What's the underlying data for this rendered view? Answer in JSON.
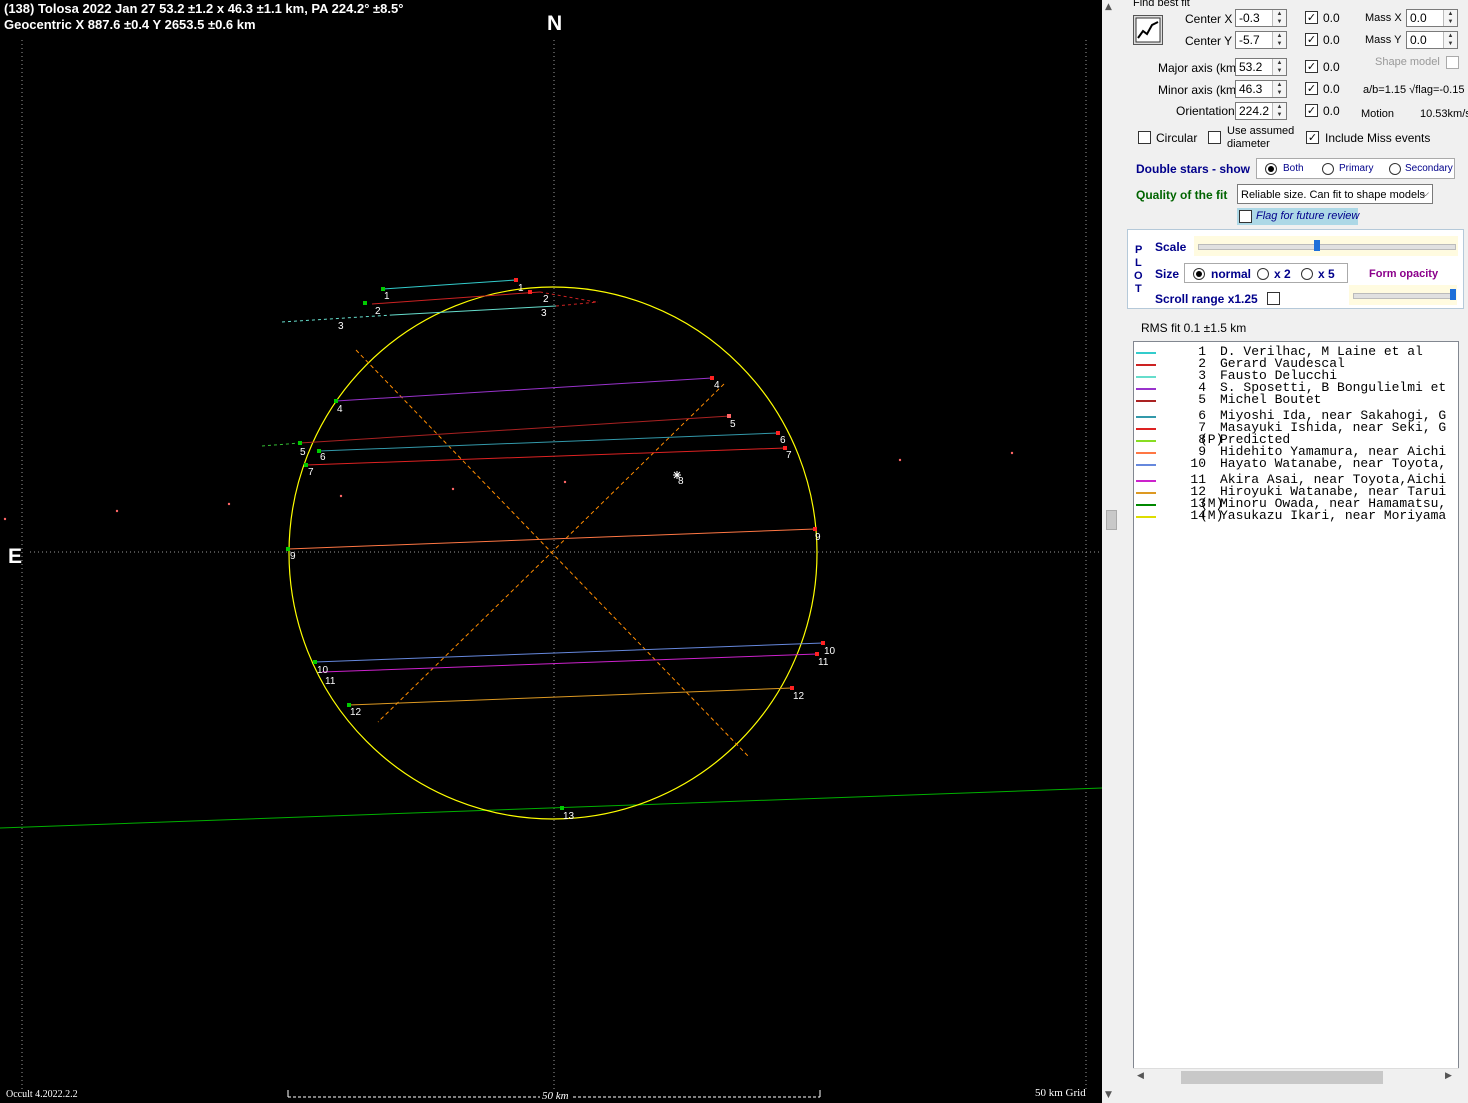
{
  "plot": {
    "title_line1": "(138) Tolosa  2022 Jan 27  53.2 ±1.2 x 46.3 ±1.1 km, PA 224.2° ±8.5°",
    "title_line2": "Geocentric  X  887.6 ±0.4  Y 2653.5 ±0.6 km",
    "north_label": "N",
    "east_label": "E",
    "version": "Occult 4.2022.2.2",
    "scale_bar_label": "50 km",
    "grid_label": "50 km Grid",
    "center_label": "8",
    "colors": {
      "background": "#000000",
      "ellipse": "#ffff00",
      "axes": "#ff8c00",
      "grid": "#9a9a9a",
      "predicted_path": "#00b000"
    }
  },
  "chords": [
    {
      "id": "1",
      "color": "#33cccc"
    },
    {
      "id": "2",
      "color": "#cc2222"
    },
    {
      "id": "3",
      "color": "#66ddcc"
    },
    {
      "id": "4",
      "color": "#9933cc"
    },
    {
      "id": "5",
      "color": "#aa2222"
    },
    {
      "id": "6",
      "color": "#3399aa"
    },
    {
      "id": "7",
      "color": "#dd2222"
    },
    {
      "id": "9",
      "color": "#ff7744"
    },
    {
      "id": "10",
      "color": "#6688dd"
    },
    {
      "id": "11",
      "color": "#cc22cc"
    },
    {
      "id": "12",
      "color": "#dd9922"
    },
    {
      "id": "13",
      "color": "#00aa00"
    }
  ],
  "panel": {
    "find_best_fit": "Find best fit",
    "center_x_label": "Center X",
    "center_x_value": "-0.3",
    "center_x_unc": "0.0",
    "center_y_label": "Center Y",
    "center_y_value": "-5.7",
    "center_y_unc": "0.0",
    "mass_x_label": "Mass X",
    "mass_x_value": "0.0",
    "mass_y_label": "Mass Y",
    "mass_y_value": "0.0",
    "shape_model_label": "Shape model",
    "major_axis_label": "Major axis (km)",
    "major_axis_value": "53.2",
    "major_axis_unc": "0.0",
    "minor_axis_label": "Minor axis (km)",
    "minor_axis_value": "46.3",
    "minor_axis_unc": "0.0",
    "orientation_label": "Orientation",
    "orientation_value": "224.2",
    "orientation_unc": "0.0",
    "ab_ratio": "a/b=1.15 √flag=-0.15",
    "motion_label": "Motion",
    "motion_value": "10.53km/s",
    "circular_label": "Circular",
    "use_assumed_label_1": "Use assumed",
    "use_assumed_label_2": "diameter",
    "include_miss_label": "Include Miss events",
    "double_stars_label": "Double stars - show",
    "ds_both": "Both",
    "ds_primary": "Primary",
    "ds_secondary": "Secondary",
    "quality_label": "Quality of the fit",
    "quality_value": "Reliable size. Can fit to shape models",
    "flag_review_label": "Flag for future review",
    "plot_vertical": [
      "P",
      "L",
      "O",
      "T"
    ],
    "scale_label": "Scale",
    "size_label": "Size",
    "size_normal": "normal",
    "size_x2": "x 2",
    "size_x5": "x 5",
    "form_opacity_label": "Form opacity",
    "scroll_range_label": "Scroll range x1.25",
    "rms_fit": "RMS fit 0.1 ±1.5 km"
  },
  "observers": [
    {
      "num": "1",
      "tag": "",
      "name": "D. Verilhac, M Laine et al",
      "color": "#33cccc"
    },
    {
      "num": "2",
      "tag": "",
      "name": "Gerard Vaudescal",
      "color": "#cc2222"
    },
    {
      "num": "3",
      "tag": "",
      "name": "Fausto Delucchi",
      "color": "#66ddcc"
    },
    {
      "num": "4",
      "tag": "",
      "name": "S. Sposetti, B Bongulielmi et",
      "color": "#9933cc"
    },
    {
      "num": "5",
      "tag": "",
      "name": "Michel Boutet",
      "color": "#aa2222"
    },
    {
      "num": "6",
      "tag": "",
      "name": "Miyoshi Ida, near Sakahogi, G",
      "color": "#3399aa"
    },
    {
      "num": "7",
      "tag": "",
      "name": "Masayuki Ishida, near Seki, G",
      "color": "#dd2222"
    },
    {
      "num": "8",
      "tag": "(P)",
      "name": "Predicted",
      "color": "#88dd22"
    },
    {
      "num": "9",
      "tag": "",
      "name": "Hidehito Yamamura, near Aichi",
      "color": "#ff7744"
    },
    {
      "num": "10",
      "tag": "",
      "name": "Hayato Watanabe, near Toyota,",
      "color": "#6688dd"
    },
    {
      "num": "11",
      "tag": "",
      "name": "Akira Asai, near Toyota,Aichi",
      "color": "#cc22cc"
    },
    {
      "num": "12",
      "tag": "",
      "name": "Hiroyuki Watanabe, near Tarui",
      "color": "#dd9922"
    },
    {
      "num": "13",
      "tag": "(M)",
      "name": "Minoru Owada, near Hamamatsu,",
      "color": "#008800"
    },
    {
      "num": "14",
      "tag": "(M)",
      "name": "Yasukazu Ikari, near Moriyama",
      "color": "#dddd00"
    }
  ]
}
